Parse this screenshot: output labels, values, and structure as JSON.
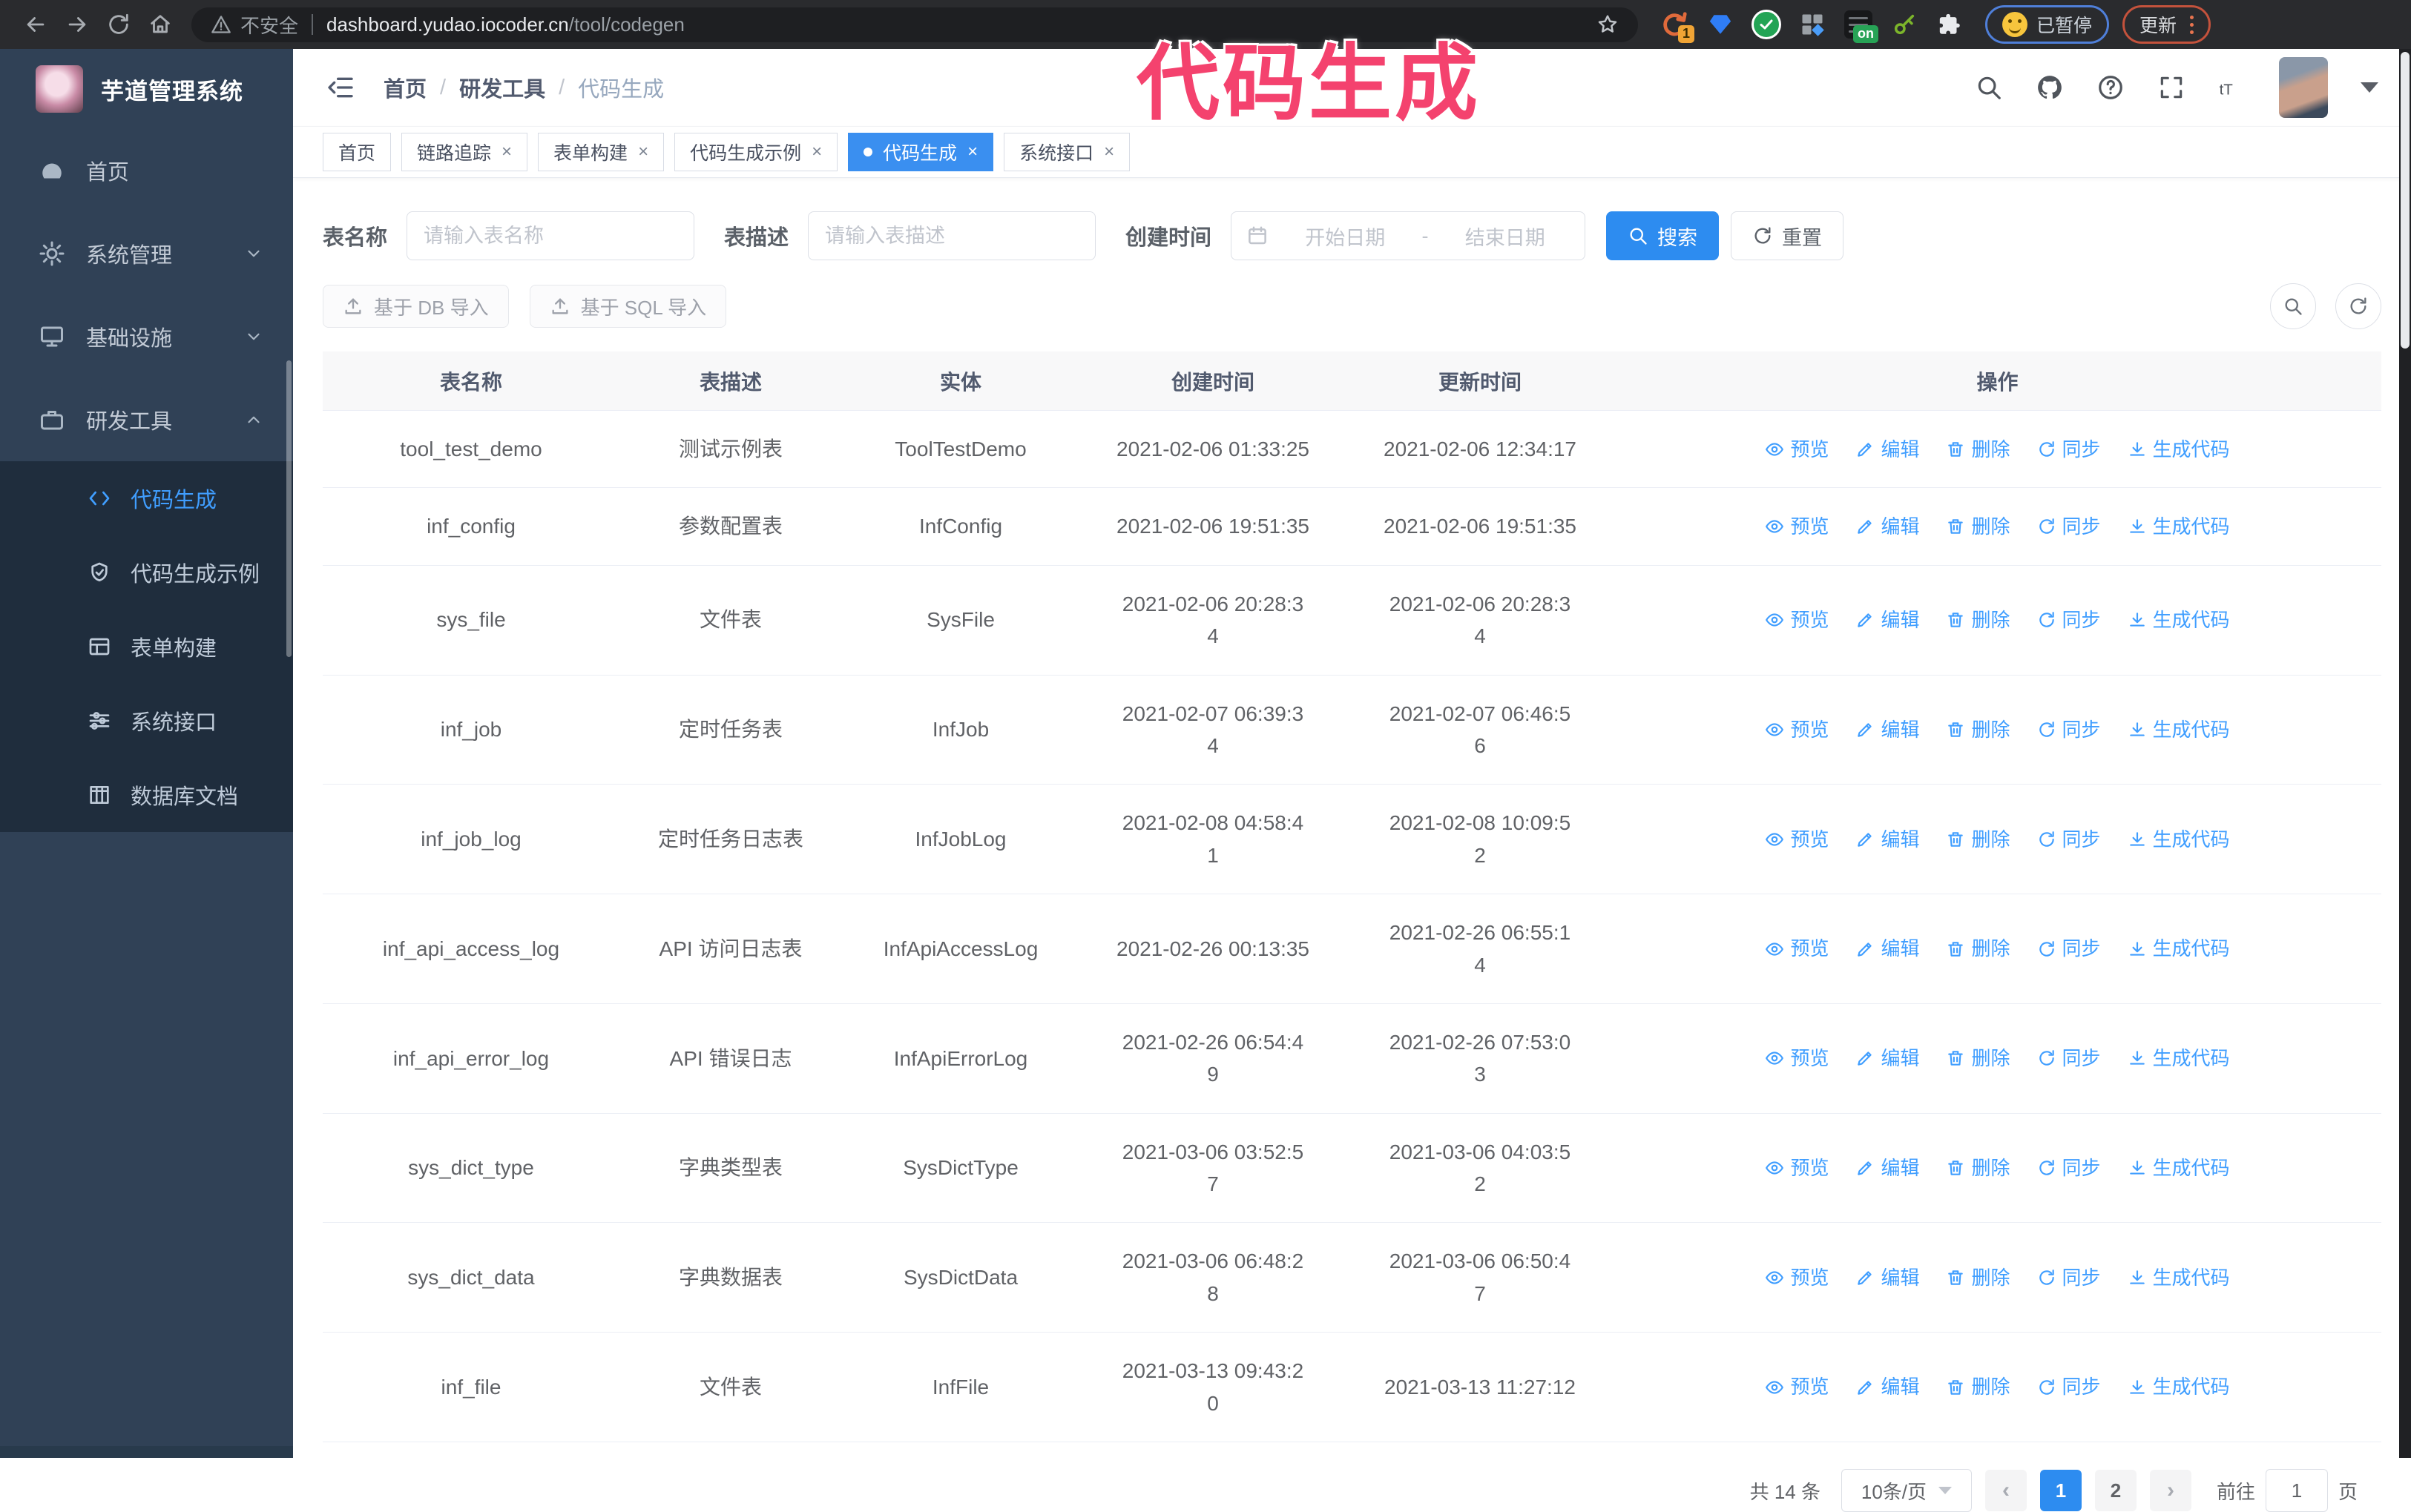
{
  "browser": {
    "security_label": "不安全",
    "url_host": "dashboard.yudao.iocoder.cn",
    "url_path": "/tool/codegen",
    "refresh_ext_badge": "1",
    "switch_ext_badge": "on",
    "paused_button": "已暂停",
    "update_button": "更新"
  },
  "annotation": {
    "text": "代码生成"
  },
  "sidebar": {
    "title": "芋道管理系统",
    "items": [
      {
        "label": "首页",
        "icon": "dashboard-icon"
      },
      {
        "label": "系统管理",
        "icon": "gear-icon"
      },
      {
        "label": "基础设施",
        "icon": "monitor-icon"
      },
      {
        "label": "研发工具",
        "icon": "briefcase-icon"
      }
    ],
    "subitems": [
      {
        "label": "代码生成",
        "icon": "code-icon",
        "active": true
      },
      {
        "label": "代码生成示例",
        "icon": "shield-check-icon"
      },
      {
        "label": "表单构建",
        "icon": "form-icon"
      },
      {
        "label": "系统接口",
        "icon": "sliders-icon"
      },
      {
        "label": "数据库文档",
        "icon": "database-icon"
      }
    ]
  },
  "header": {
    "breadcrumb": [
      "首页",
      "研发工具",
      "代码生成"
    ],
    "separator": "/"
  },
  "tags": [
    {
      "label": "首页"
    },
    {
      "label": "链路追踪"
    },
    {
      "label": "表单构建"
    },
    {
      "label": "代码生成示例"
    },
    {
      "label": "代码生成"
    },
    {
      "label": "系统接口"
    }
  ],
  "search_form": {
    "table_name_label": "表名称",
    "table_name_placeholder": "请输入表名称",
    "table_desc_label": "表描述",
    "table_desc_placeholder": "请输入表描述",
    "created_label": "创建时间",
    "start_placeholder": "开始日期",
    "range_separator": "-",
    "end_placeholder": "结束日期",
    "search_button": "搜索",
    "reset_button": "重置"
  },
  "toolbar": {
    "import_db": "基于 DB 导入",
    "import_sql": "基于 SQL 导入"
  },
  "table": {
    "columns": [
      "表名称",
      "表描述",
      "实体",
      "创建时间",
      "更新时间",
      "操作"
    ],
    "actions": [
      "预览",
      "编辑",
      "删除",
      "同步",
      "生成代码"
    ],
    "rows": [
      {
        "name": "tool_test_demo",
        "desc": "测试示例表",
        "entity": "ToolTestDemo",
        "created": "2021-02-06 01:33:25",
        "updated": "2021-02-06 12:34:17"
      },
      {
        "name": "inf_config",
        "desc": "参数配置表",
        "entity": "InfConfig",
        "created": "2021-02-06 19:51:35",
        "updated": "2021-02-06 19:51:35"
      },
      {
        "name": "sys_file",
        "desc": "文件表",
        "entity": "SysFile",
        "created": "2021-02-06 20:28:3\n4",
        "updated": "2021-02-06 20:28:3\n4"
      },
      {
        "name": "inf_job",
        "desc": "定时任务表",
        "entity": "InfJob",
        "created": "2021-02-07 06:39:3\n4",
        "updated": "2021-02-07 06:46:5\n6"
      },
      {
        "name": "inf_job_log",
        "desc": "定时任务日志表",
        "entity": "InfJobLog",
        "created": "2021-02-08 04:58:4\n1",
        "updated": "2021-02-08 10:09:5\n2"
      },
      {
        "name": "inf_api_access_log",
        "desc": "API 访问日志表",
        "entity": "InfApiAccessLog",
        "created": "2021-02-26 00:13:35",
        "updated": "2021-02-26 06:55:1\n4"
      },
      {
        "name": "inf_api_error_log",
        "desc": "API 错误日志",
        "entity": "InfApiErrorLog",
        "created": "2021-02-26 06:54:4\n9",
        "updated": "2021-02-26 07:53:0\n3"
      },
      {
        "name": "sys_dict_type",
        "desc": "字典类型表",
        "entity": "SysDictType",
        "created": "2021-03-06 03:52:5\n7",
        "updated": "2021-03-06 04:03:5\n2"
      },
      {
        "name": "sys_dict_data",
        "desc": "字典数据表",
        "entity": "SysDictData",
        "created": "2021-03-06 06:48:2\n8",
        "updated": "2021-03-06 06:50:4\n7"
      },
      {
        "name": "inf_file",
        "desc": "文件表",
        "entity": "InfFile",
        "created": "2021-03-13 09:43:2\n0",
        "updated": "2021-03-13 11:27:12"
      }
    ]
  },
  "pagination": {
    "total": "共 14 条",
    "page_size": "10条/页",
    "page_1": "1",
    "page_2": "2",
    "goto_label": "前往",
    "goto_value": "1",
    "page_unit": "页"
  }
}
